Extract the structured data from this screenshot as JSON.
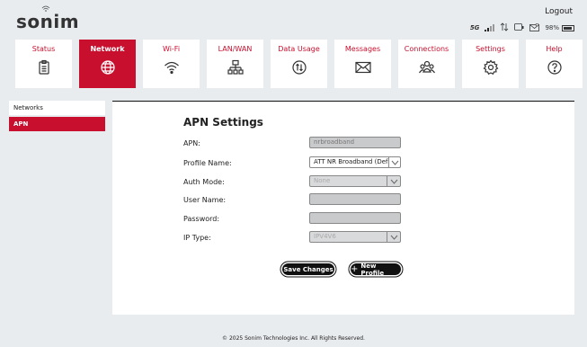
{
  "header": {
    "brand": "sonim",
    "logout_label": "Logout",
    "network_type": "5G",
    "battery": "98%"
  },
  "nav": {
    "tabs": [
      {
        "label": "Status",
        "icon": "status-clipboard-icon"
      },
      {
        "label": "Network",
        "icon": "globe-icon"
      },
      {
        "label": "Wi-Fi",
        "icon": "wifi-icon"
      },
      {
        "label": "LAN/WAN",
        "icon": "lan-icon"
      },
      {
        "label": "Data Usage",
        "icon": "data-usage-icon"
      },
      {
        "label": "Messages",
        "icon": "envelope-icon"
      },
      {
        "label": "Connections",
        "icon": "people-icon"
      },
      {
        "label": "Settings",
        "icon": "gear-icon"
      },
      {
        "label": "Help",
        "icon": "help-icon"
      }
    ],
    "active": "Network"
  },
  "sidebar": {
    "items": [
      {
        "label": "Networks"
      },
      {
        "label": "APN"
      }
    ],
    "active": "APN"
  },
  "apn": {
    "title": "APN Settings",
    "fields": {
      "apn": {
        "label": "APN:",
        "value": "nrbroadband"
      },
      "profile_name": {
        "label": "Profile Name:",
        "value": "ATT NR Broadband (Default)"
      },
      "auth_mode": {
        "label": "Auth Mode:",
        "value": "None"
      },
      "user_name": {
        "label": "User Name:",
        "value": ""
      },
      "password": {
        "label": "Password:",
        "value": ""
      },
      "ip_type": {
        "label": "IP Type:",
        "value": "IPV4V6"
      }
    },
    "save_label": "Save Changes",
    "new_profile_label": "New Profile"
  },
  "footer": {
    "text": "© 2025 Sonim Technologies Inc. All Rights Reserved."
  },
  "colors": {
    "accent": "#c8102e",
    "background": "#e9ecef"
  }
}
